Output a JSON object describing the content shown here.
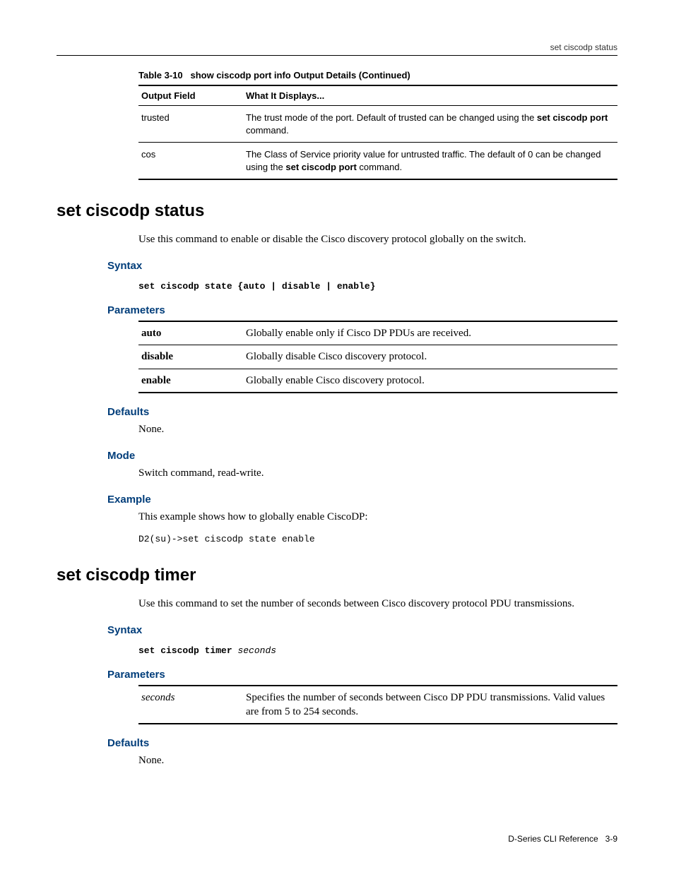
{
  "header_right": "set ciscodp status",
  "table310": {
    "caption_prefix": "Table 3-10",
    "caption_title": "show ciscodp port info Output Details  (Continued)",
    "head_col1": "Output Field",
    "head_col2": "What It Displays...",
    "rows": [
      {
        "field": "trusted",
        "desc_prefix": "The trust mode of the port. Default of trusted can be changed using the ",
        "desc_bold": "set ciscodp port",
        "desc_suffix": " command."
      },
      {
        "field": "cos",
        "desc_prefix": "The Class of Service priority value for untrusted traffic. The default of 0 can be changed using the ",
        "desc_bold": "set ciscodp port",
        "desc_suffix": " command."
      }
    ]
  },
  "status": {
    "title": "set ciscodp status",
    "intro": "Use this command to enable or disable the Cisco discovery protocol globally on the switch.",
    "syntax_h": "Syntax",
    "syntax_cmd": "set ciscodp state",
    "syntax_args": " {auto | disable | enable}",
    "params_h": "Parameters",
    "params": [
      {
        "name": "auto",
        "desc": "Globally enable only if Cisco DP PDUs are received."
      },
      {
        "name": "disable",
        "desc": "Globally disable Cisco discovery protocol."
      },
      {
        "name": "enable",
        "desc": "Globally enable Cisco discovery protocol."
      }
    ],
    "defaults_h": "Defaults",
    "defaults_text": "None.",
    "mode_h": "Mode",
    "mode_text": "Switch command, read-write.",
    "example_h": "Example",
    "example_text": "This example shows how to globally enable CiscoDP:",
    "example_code": "D2(su)->set ciscodp state enable"
  },
  "timer": {
    "title": "set ciscodp timer",
    "intro": "Use this command to set the number of seconds between Cisco discovery protocol PDU transmissions.",
    "syntax_h": "Syntax",
    "syntax_cmd": "set ciscodp timer ",
    "syntax_arg": "seconds",
    "params_h": "Parameters",
    "param_name": "seconds",
    "param_desc": "Specifies the number of seconds between Cisco DP PDU transmissions. Valid values are from 5 to 254 seconds.",
    "defaults_h": "Defaults",
    "defaults_text": "None."
  },
  "footer": {
    "doc": "D-Series CLI Reference",
    "page": "3-9"
  }
}
